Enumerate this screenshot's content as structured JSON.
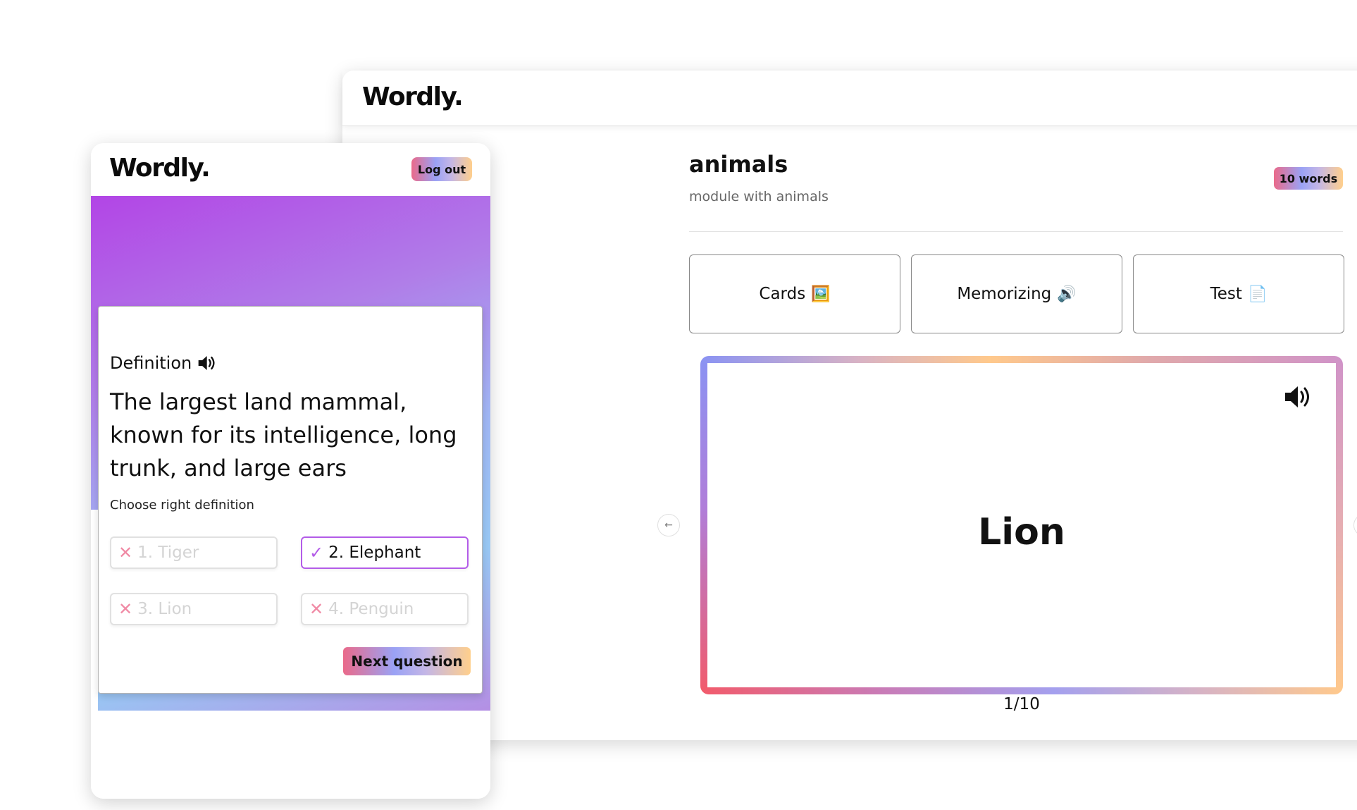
{
  "desktop": {
    "logo": "Wordly.",
    "module": {
      "title": "animals",
      "description": "module with animals",
      "word_count_badge": "10 words"
    },
    "tabs": [
      {
        "label": "Cards",
        "emoji": "🖼️"
      },
      {
        "label": "Memorizing",
        "emoji": "🔊"
      },
      {
        "label": "Test",
        "emoji": "📄"
      }
    ],
    "flashcard": {
      "word": "Lion",
      "speaker_icon": "speaker-icon"
    },
    "counter": "1/10",
    "nav": {
      "prev_icon": "arrow-left-icon",
      "next_icon": "arrow-right-icon"
    }
  },
  "mobile": {
    "logo": "Wordly.",
    "logout_label": "Log out",
    "quiz": {
      "label": "Definition",
      "definition": "The largest land mammal, known for its intelligence, long trunk, and large ears",
      "hint": "Choose right definition",
      "options": [
        {
          "text": "1. Tiger",
          "state": "wrong"
        },
        {
          "text": "2. Elephant",
          "state": "correct"
        },
        {
          "text": "3. Lion",
          "state": "wrong"
        },
        {
          "text": "4. Penguin",
          "state": "wrong"
        }
      ],
      "next_label": "Next question"
    }
  },
  "colors": {
    "accent_purple": "#b35ce8",
    "wrong_pink": "#f08aa5",
    "gradient_start": "#ea6a8a",
    "gradient_end": "#ffcf8c"
  }
}
